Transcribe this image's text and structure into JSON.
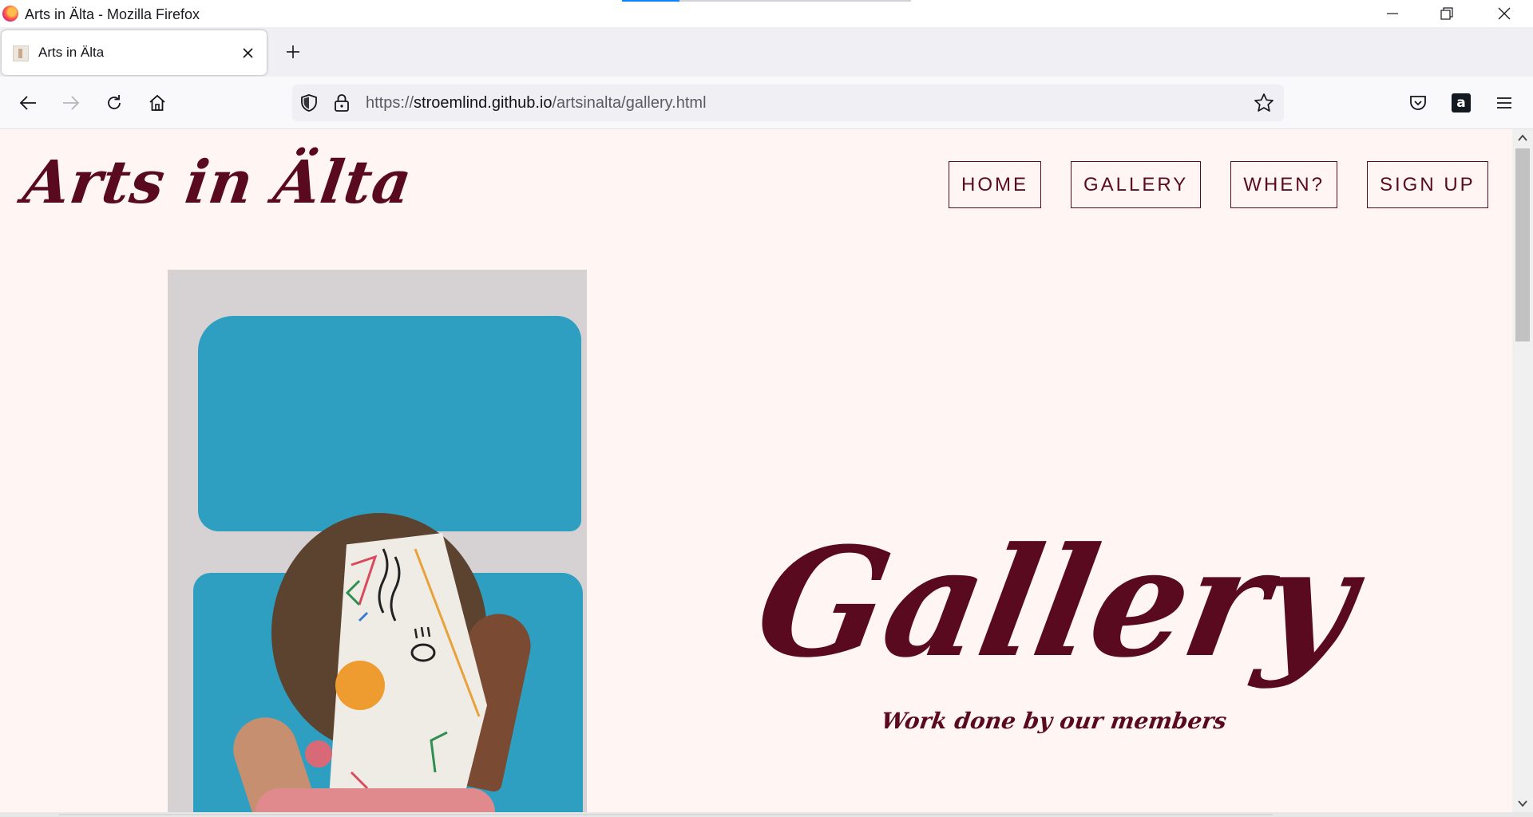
{
  "window": {
    "title": "Arts in Älta - Mozilla Firefox",
    "firefox_icon": "firefox-logo",
    "controls": [
      "minimize-icon",
      "restore-icon",
      "close-icon"
    ]
  },
  "tabs": [
    {
      "label": "Arts in Älta",
      "active": true
    }
  ],
  "toolbar": {
    "back_icon": "arrow-left-icon",
    "forward_icon": "arrow-right-icon",
    "reload_icon": "reload-icon",
    "home_icon": "home-icon",
    "url_prefix": "https://",
    "url_host": "stroemlind.github.io",
    "url_path": "/artsinalta/gallery.html",
    "right_icons": [
      "pocket-icon",
      "amazon-extension-icon",
      "menu-icon"
    ],
    "amazon_glyph": "a"
  },
  "site": {
    "logo": "Arts in Älta",
    "nav": [
      "HOME",
      "GALLERY",
      "WHEN?",
      "SIGN UP"
    ],
    "hero_title": "Gallery",
    "hero_subtitle": "Work done by our members"
  },
  "colors": {
    "brand": "#5a0a1f",
    "page_background": "#fff5f2",
    "accent_blue": "#2f9fc1"
  }
}
